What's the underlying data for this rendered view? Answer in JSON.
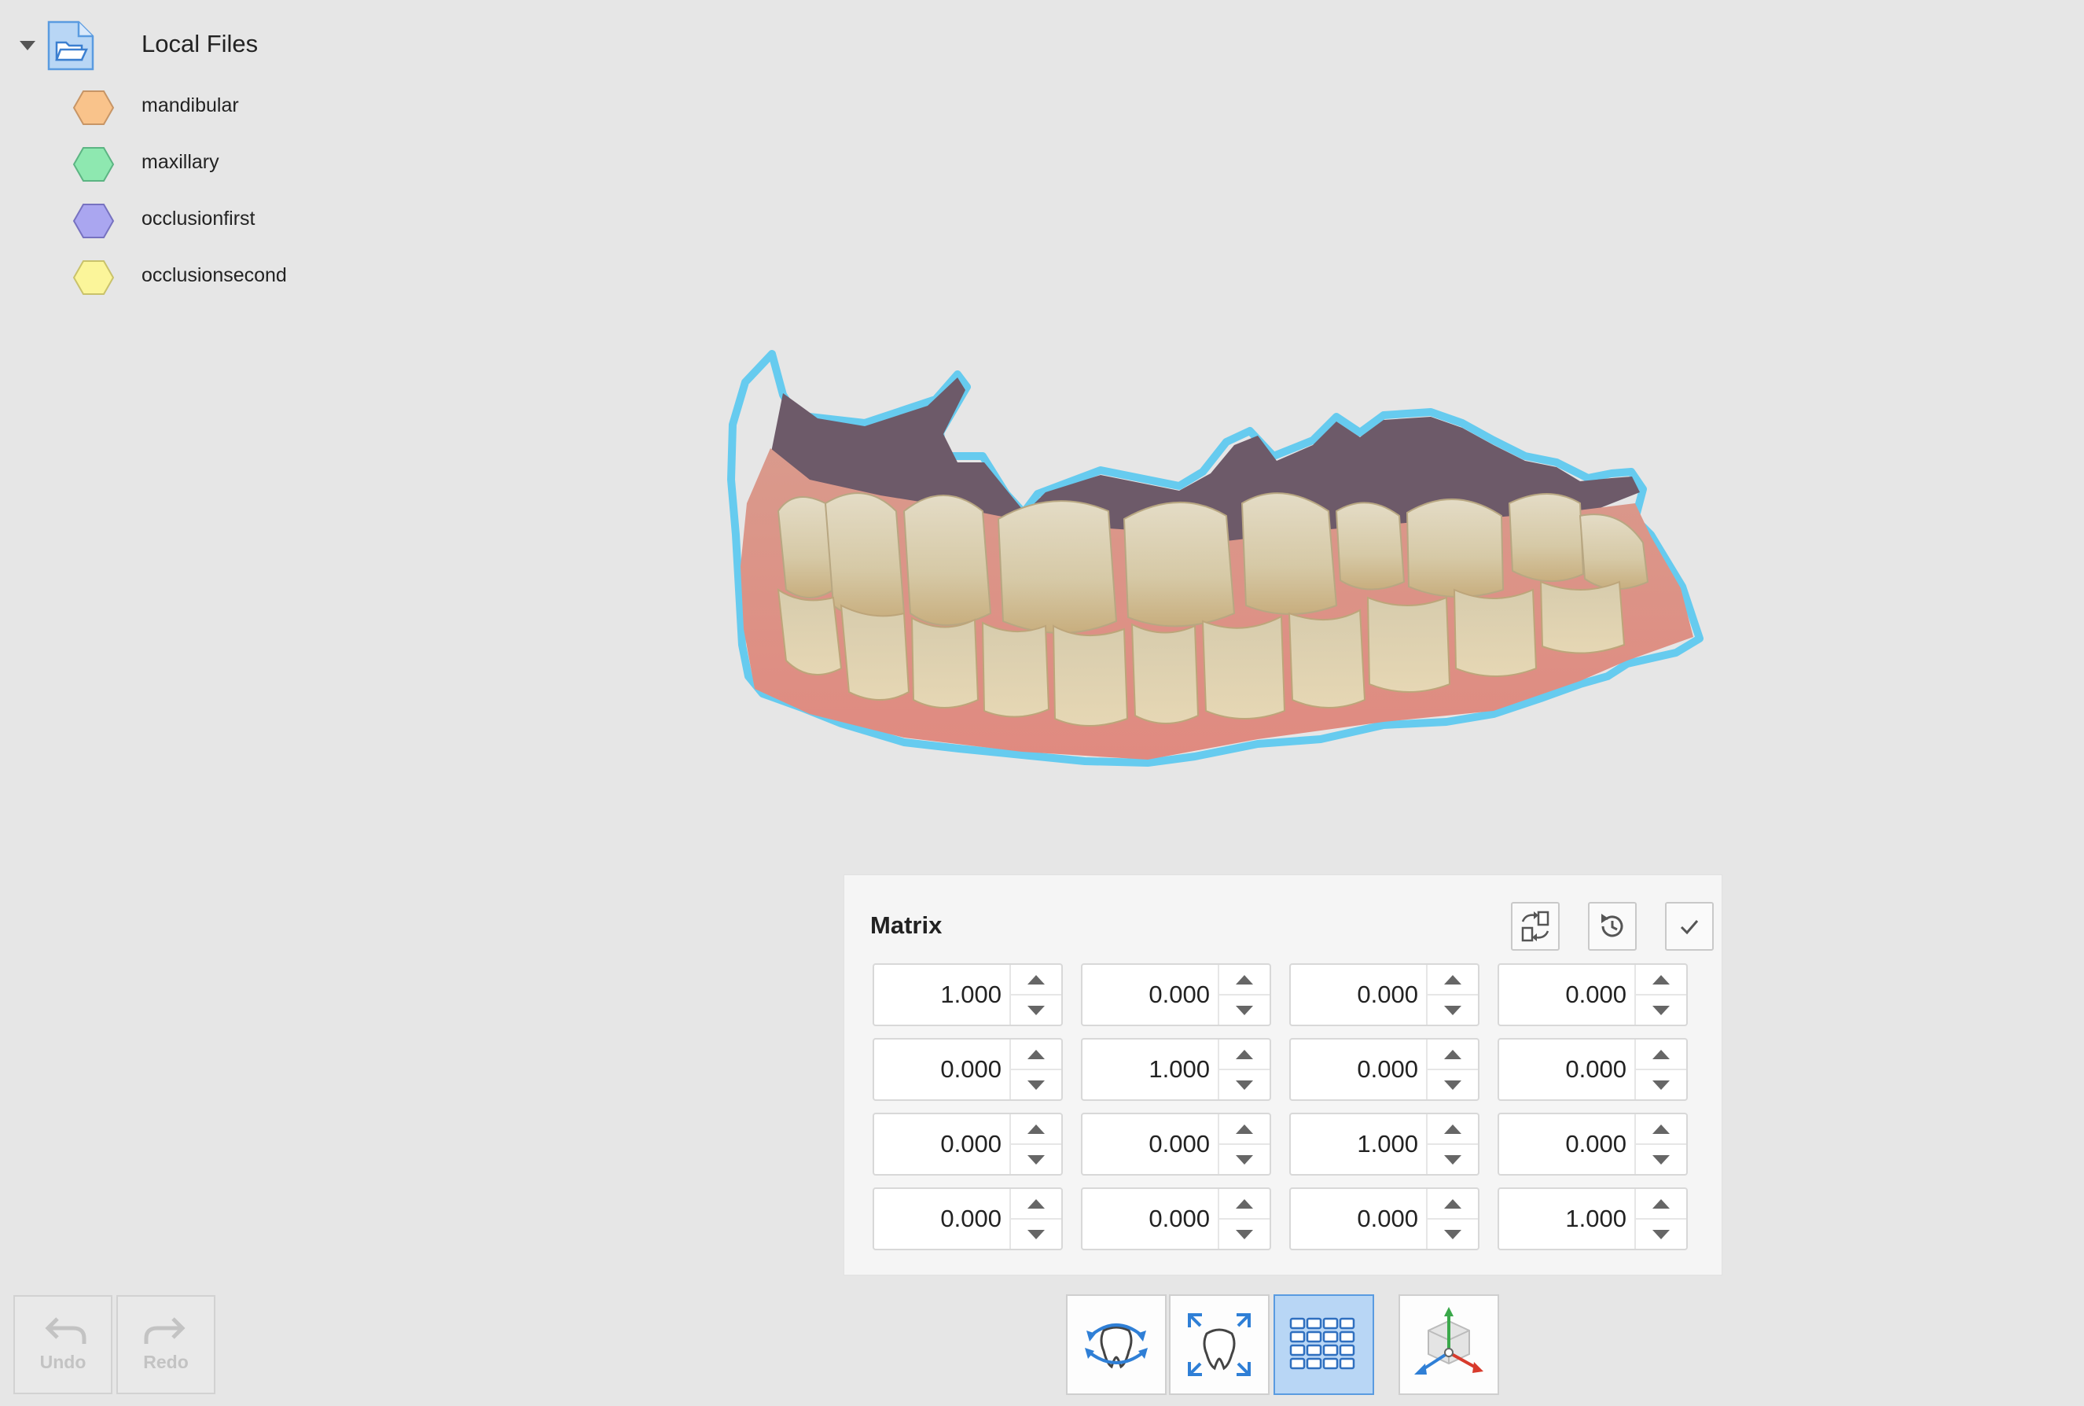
{
  "file_tree": {
    "root_label": "Local Files",
    "items": [
      {
        "label": "mandibular",
        "color": "#f9c38b",
        "stroke": "#c79566"
      },
      {
        "label": "maxillary",
        "color": "#8ee8b0",
        "stroke": "#5cb483"
      },
      {
        "label": "occlusionfirst",
        "color": "#aaa6f0",
        "stroke": "#7772c0"
      },
      {
        "label": "occlusionsecond",
        "color": "#fbf59a",
        "stroke": "#c9c26b"
      }
    ]
  },
  "matrix_panel": {
    "title": "Matrix",
    "actions": {
      "swap": "swap-icon",
      "reset": "reset-icon",
      "confirm": "check-icon"
    },
    "rows": [
      [
        "1.000",
        "0.000",
        "0.000",
        "0.000"
      ],
      [
        "0.000",
        "1.000",
        "0.000",
        "0.000"
      ],
      [
        "0.000",
        "0.000",
        "1.000",
        "0.000"
      ],
      [
        "0.000",
        "0.000",
        "0.000",
        "1.000"
      ]
    ]
  },
  "history": {
    "undo_label": "Undo",
    "redo_label": "Redo"
  },
  "toolbar": {
    "tools": [
      {
        "name": "rotate-view-tool",
        "icon": "rotate-tooth-icon",
        "active": false
      },
      {
        "name": "fit-view-tool",
        "icon": "fit-tooth-icon",
        "active": false
      },
      {
        "name": "matrix-grid-tool",
        "icon": "grid-icon",
        "active": true
      },
      {
        "name": "axis-tool",
        "icon": "axis-cube-icon",
        "active": false
      }
    ]
  },
  "colors": {
    "accent": "#5a9be0",
    "active_background": "#b8d6f5",
    "model_highlight": "#4fc6f0"
  }
}
